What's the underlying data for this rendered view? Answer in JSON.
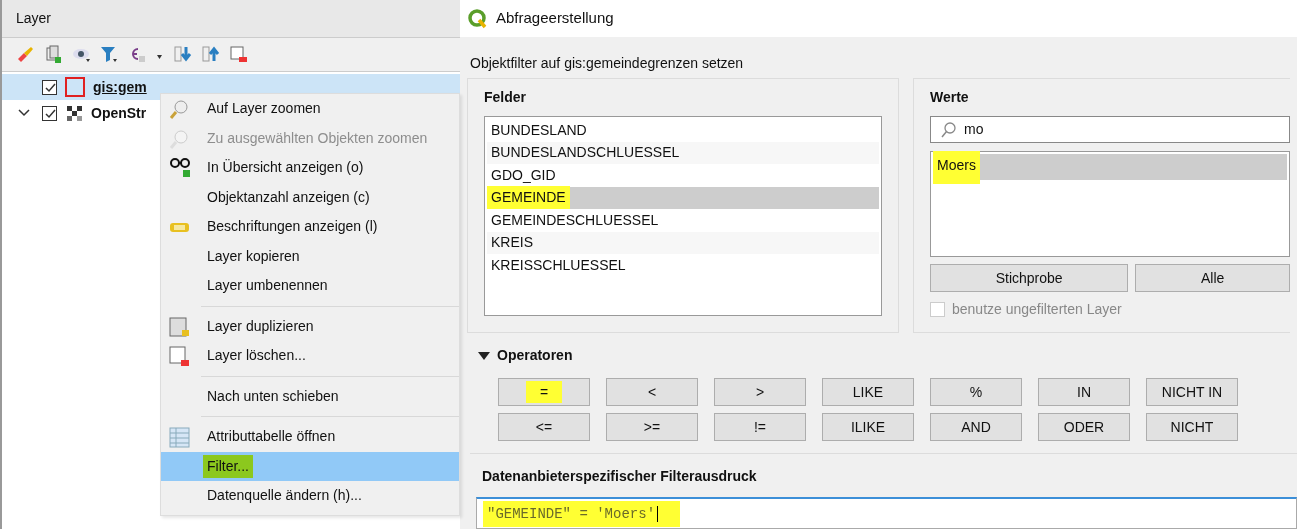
{
  "layer_panel": {
    "title": "Layer",
    "layers": [
      {
        "name": "gis:gem",
        "checked": true,
        "selected": true,
        "expandable": false
      },
      {
        "name": "OpenStr",
        "checked": true,
        "selected": false,
        "expandable": true
      }
    ]
  },
  "context_menu": {
    "items": [
      {
        "kind": "item",
        "label": "Auf Layer zoomen",
        "disabled": false,
        "selected": false,
        "highlighted": false
      },
      {
        "kind": "item",
        "label": "Zu ausgewählten Objekten zoomen",
        "disabled": true,
        "selected": false,
        "highlighted": false
      },
      {
        "kind": "item",
        "label": "In Übersicht anzeigen (o)",
        "disabled": false,
        "selected": false,
        "highlighted": false
      },
      {
        "kind": "item",
        "label": "Objektanzahl anzeigen (c)",
        "disabled": false,
        "selected": false,
        "highlighted": false
      },
      {
        "kind": "item",
        "label": "Beschriftungen anzeigen (l)",
        "disabled": false,
        "selected": false,
        "highlighted": false
      },
      {
        "kind": "item",
        "label": "Layer kopieren",
        "disabled": false,
        "selected": false,
        "highlighted": false
      },
      {
        "kind": "item",
        "label": "Layer umbenennen",
        "disabled": false,
        "selected": false,
        "highlighted": false
      },
      {
        "kind": "separator"
      },
      {
        "kind": "item",
        "label": "Layer duplizieren",
        "disabled": false,
        "selected": false,
        "highlighted": false
      },
      {
        "kind": "item",
        "label": "Layer löschen...",
        "disabled": false,
        "selected": false,
        "highlighted": false
      },
      {
        "kind": "separator"
      },
      {
        "kind": "item",
        "label": "Nach unten schieben",
        "disabled": false,
        "selected": false,
        "highlighted": false
      },
      {
        "kind": "separator"
      },
      {
        "kind": "item",
        "label": "Attributtabelle öffnen",
        "disabled": false,
        "selected": false,
        "highlighted": false
      },
      {
        "kind": "item",
        "label": "Filter...",
        "disabled": false,
        "selected": true,
        "highlighted": true
      },
      {
        "kind": "item",
        "label": "Datenquelle ändern (h)...",
        "disabled": false,
        "selected": false,
        "highlighted": false
      }
    ]
  },
  "dialog": {
    "title": "Abfrageerstellung",
    "subtitle": "Objektfilter auf gis:gemeindegrenzen setzen",
    "fields": {
      "title": "Felder",
      "items": [
        {
          "label": "BUNDESLAND",
          "selected": false,
          "highlighted": false
        },
        {
          "label": "BUNDESLANDSCHLUESSEL",
          "selected": false,
          "highlighted": false
        },
        {
          "label": "GDO_GID",
          "selected": false,
          "highlighted": false
        },
        {
          "label": "GEMEINDE",
          "selected": true,
          "highlighted": true
        },
        {
          "label": "GEMEINDESCHLUESSEL",
          "selected": false,
          "highlighted": false
        },
        {
          "label": "KREIS",
          "selected": false,
          "highlighted": false
        },
        {
          "label": "KREISSCHLUESSEL",
          "selected": false,
          "highlighted": false
        }
      ]
    },
    "values": {
      "title": "Werte",
      "search": "mo",
      "items": [
        {
          "label": "Moers",
          "selected": true,
          "highlighted": true
        }
      ],
      "buttons": [
        "Stichprobe",
        "Alle"
      ],
      "checkbox": {
        "label": "benutze ungefilterten Layer",
        "checked": false,
        "disabled": true
      }
    },
    "operators": {
      "title": "Operatoren",
      "expanded": true,
      "rows": [
        [
          {
            "label": "=",
            "highlighted": true
          },
          {
            "label": "<",
            "highlighted": false
          },
          {
            "label": ">",
            "highlighted": false
          },
          {
            "label": "LIKE",
            "highlighted": false
          },
          {
            "label": "%",
            "highlighted": false
          },
          {
            "label": "IN",
            "highlighted": false
          },
          {
            "label": "NICHT IN",
            "highlighted": false
          }
        ],
        [
          {
            "label": "<=",
            "highlighted": false
          },
          {
            "label": ">=",
            "highlighted": false
          },
          {
            "label": "!=",
            "highlighted": false
          },
          {
            "label": "ILIKE",
            "highlighted": false
          },
          {
            "label": "AND",
            "highlighted": false
          },
          {
            "label": "ODER",
            "highlighted": false
          },
          {
            "label": "NICHT",
            "highlighted": false
          }
        ]
      ]
    },
    "expression": {
      "title": "Datenanbieterspezifischer Filterausdruck",
      "value": "\"GEMEINDE\" = 'Moers'",
      "highlighted": true
    }
  }
}
